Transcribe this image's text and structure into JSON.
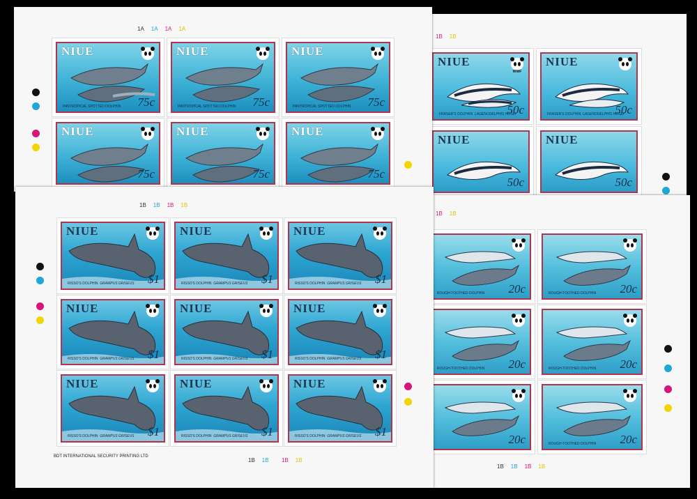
{
  "stamps": {
    "country": "NIUE",
    "wwf": "WWF",
    "v75": {
      "value": "75c",
      "name": "PANTROPICAL SPOTTED DOLPHIN"
    },
    "v50": {
      "value": "50c",
      "name": "FRASER'S DOLPHIN",
      "latin": "Lagenodelphis hosei"
    },
    "v1": {
      "value": "$1",
      "name": "RISSO'S DOLPHIN",
      "latin": "Grampus griseus"
    },
    "v20": {
      "value": "20c",
      "name": "ROUGH-TOOTHED DOLPHIN"
    }
  },
  "plates": {
    "s1": [
      "1A",
      "1A",
      "1A",
      "1A"
    ],
    "s2": [
      "1B",
      "1B"
    ],
    "s3": [
      "1B",
      "1B",
      "1B",
      "1B"
    ],
    "s3b": [
      "1B",
      "1B",
      "1B",
      "1B"
    ],
    "s4": [
      "1B",
      "1B",
      "1B",
      "1B"
    ]
  },
  "imprint": "BDT INTERNATIONAL SECURITY PRINTING LTD",
  "colors": {
    "black": "#111111",
    "cyan": "#20a7d8",
    "magenta": "#d8147a",
    "yellow": "#f2d400",
    "frame": "#b3334a"
  }
}
